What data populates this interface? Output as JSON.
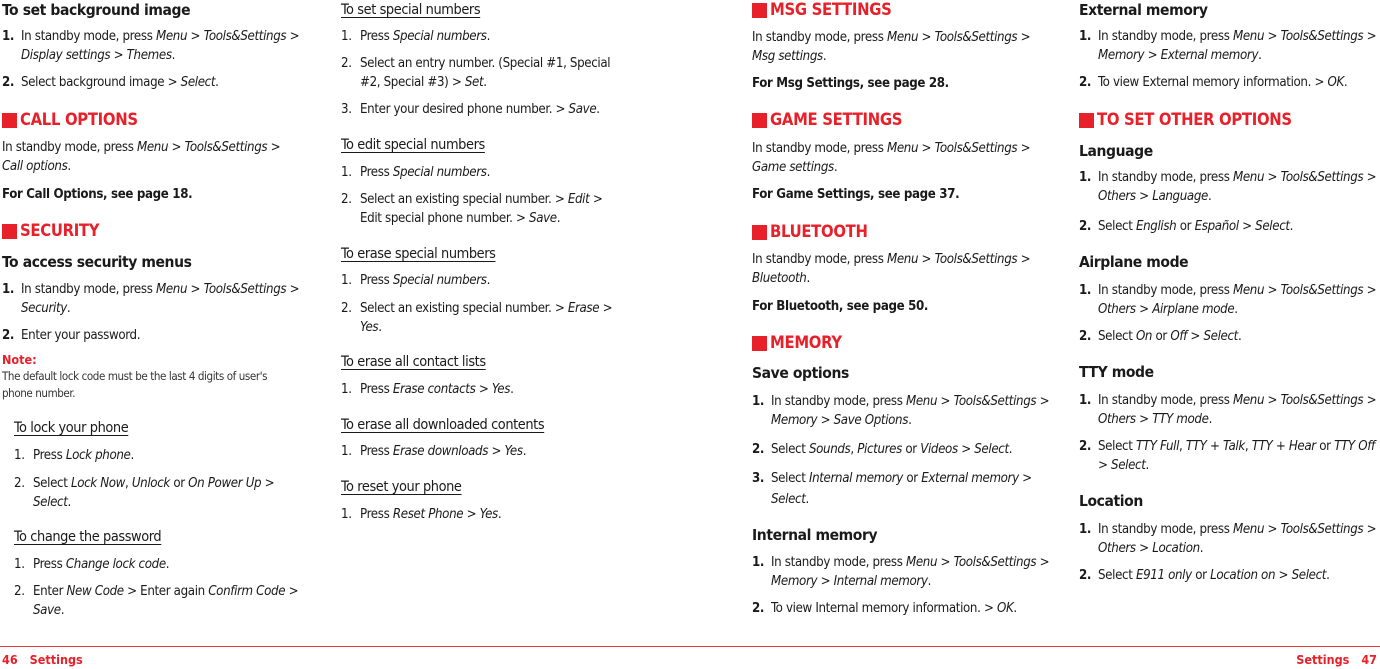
{
  "colors": {
    "accent": "#e8202a",
    "text": "#1a1a1a"
  },
  "footer": {
    "left_page": "46",
    "left_title": "Settings",
    "right_title": "Settings",
    "right_page": "47"
  },
  "col1": {
    "bg_heading": "To set background image",
    "bg_step1_pre": "In standby mode, press ",
    "bg_step1_i1": "Menu",
    "bg_step1_m1": " > ",
    "bg_step1_i2": "Tools&Settings",
    "bg_step1_m2": " > ",
    "bg_step1_i3": "Display settings",
    "bg_step1_m3": " > ",
    "bg_step1_i4": "Themes",
    "bg_step1_end": ".",
    "bg_step2_pre": "Select background image > ",
    "bg_step2_i1": "Select",
    "bg_step2_end": ".",
    "call_heading": "CALL OPTIONS",
    "call_text_pre": "In standby mode, press ",
    "call_text_i1": "Menu",
    "call_text_m1": " > ",
    "call_text_i2": "Tools&Settings",
    "call_text_m2": " > ",
    "call_text_i3": "Call options",
    "call_text_end": ".",
    "call_ref": "For Call Options, see page 18.",
    "security_heading": "SECURITY",
    "access_heading": "To access security menus",
    "access_step1_pre": "In standby mode, press ",
    "access_step1_i1": "Menu",
    "access_step1_m1": " > ",
    "access_step1_i2": "Tools&Settings",
    "access_step1_m2": " > ",
    "access_step1_i3": "Security",
    "access_step1_end": ".",
    "access_step2": "Enter your password.",
    "note_label": "Note:",
    "note_text": "The default lock code must be the last 4 digits of user's phone number.",
    "lock_heading": "To lock your phone",
    "lock_step1_pre": "Press ",
    "lock_step1_i1": "Lock phone",
    "lock_step1_end": ".",
    "lock_step2_pre": "Select ",
    "lock_step2_i1": "Lock Now",
    "lock_step2_m1": ", ",
    "lock_step2_i2": "Unlock",
    "lock_step2_m2": " or ",
    "lock_step2_i3": "On Power Up",
    "lock_step2_m3": " > ",
    "lock_step2_i4": "Select",
    "lock_step2_end": ".",
    "pw_heading": "To change the password",
    "pw_step1_pre": "Press ",
    "pw_step1_i1": "Change lock code",
    "pw_step1_end": ".",
    "pw_step2_pre": "Enter ",
    "pw_step2_i1": "New Code",
    "pw_step2_m1": " > Enter again ",
    "pw_step2_i2": "Confirm Code",
    "pw_step2_m2": " > ",
    "pw_step2_i3": "Save",
    "pw_step2_end": "."
  },
  "col2": {
    "set_heading": "To set special numbers",
    "set_step1_pre": "Press ",
    "set_step1_i1": "Special numbers",
    "set_step1_end": ".",
    "set_step2_pre": "Select an entry number. (Special #1, Special #2, Special #3) > ",
    "set_step2_i1": "Set",
    "set_step2_end": ".",
    "set_step3_pre": "Enter your desired phone number. > ",
    "set_step3_i1": "Save",
    "set_step3_end": ".",
    "edit_heading": "To edit special numbers",
    "edit_step1_pre": "Press ",
    "edit_step1_i1": "Special numbers",
    "edit_step1_end": ".",
    "edit_step2_pre": "Select an existing special number. > ",
    "edit_step2_i1": "Edit",
    "edit_step2_m1": " > Edit special phone number. > ",
    "edit_step2_i2": "Save",
    "edit_step2_end": ".",
    "erase_heading": "To erase special numbers",
    "erase_step1_pre": "Press ",
    "erase_step1_i1": "Special numbers",
    "erase_step1_end": ".",
    "erase_step2_pre": "Select an existing special number. > ",
    "erase_step2_i1": "Erase",
    "erase_step2_m1": " > ",
    "erase_step2_i2": "Yes",
    "erase_step2_end": ".",
    "contacts_heading": "To erase all contact lists",
    "contacts_step1_pre": "Press ",
    "contacts_step1_i1": "Erase contacts",
    "contacts_step1_m1": " > ",
    "contacts_step1_i2": "Yes",
    "contacts_step1_end": ".",
    "downloads_heading": "To erase all downloaded contents",
    "downloads_step1_pre": "Press ",
    "downloads_step1_i1": "Erase downloads",
    "downloads_step1_m1": " > ",
    "downloads_step1_i2": "Yes",
    "downloads_step1_end": ".",
    "reset_heading": "To reset your phone",
    "reset_step1_pre": "Press ",
    "reset_step1_i1": "Reset Phone",
    "reset_step1_m1": " > ",
    "reset_step1_i2": "Yes",
    "reset_step1_end": "."
  },
  "col3": {
    "msg_heading": "MSG SETTINGS",
    "msg_text_pre": "In standby mode, press ",
    "msg_text_i1": "Menu",
    "msg_text_m1": " > ",
    "msg_text_i2": "Tools&Settings",
    "msg_text_m2": " > ",
    "msg_text_i3": "Msg settings",
    "msg_text_end": ".",
    "msg_ref": "For Msg Settings, see page 28.",
    "game_heading": "GAME SETTINGS",
    "game_text_pre": "In standby mode, press ",
    "game_text_i1": "Menu",
    "game_text_m1": " > ",
    "game_text_i2": "Tools&Settings",
    "game_text_m2": " > ",
    "game_text_i3": "Game settings",
    "game_text_end": ".",
    "game_ref": "For Game Settings, see page 37.",
    "bt_heading": "BLUETOOTH",
    "bt_text_pre": "In standby mode, press ",
    "bt_text_i1": "Menu",
    "bt_text_m1": " > ",
    "bt_text_i2": "Tools&Settings",
    "bt_text_m2": " > ",
    "bt_text_i3": "Bluetooth",
    "bt_text_end": ".",
    "bt_ref": "For Bluetooth, see page 50.",
    "mem_heading": "MEMORY",
    "save_heading": "Save options",
    "save_step1_pre": "In standby mode, press ",
    "save_step1_i1": "Menu",
    "save_step1_m1": " > ",
    "save_step1_i2": "Tools&Settings",
    "save_step1_m2": " > ",
    "save_step1_i3": "Memory",
    "save_step1_m3": " > ",
    "save_step1_i4": "Save Options",
    "save_step1_end": ".",
    "save_step2_pre": "Select ",
    "save_step2_i1": "Sounds",
    "save_step2_m1": ", ",
    "save_step2_i2": "Pictures",
    "save_step2_m2": " or ",
    "save_step2_i3": "Videos",
    "save_step2_m3": " > ",
    "save_step2_i4": "Select",
    "save_step2_end": ".",
    "save_step3_pre": "Select ",
    "save_step3_i1": "Internal memory",
    "save_step3_m1": " or ",
    "save_step3_i2": "External memory",
    "save_step3_m2": " > ",
    "save_step3_i3": "Select",
    "save_step3_end": ".",
    "int_heading": "Internal memory",
    "int_step1_pre": "In standby mode, press ",
    "int_step1_i1": "Menu",
    "int_step1_m1": " > ",
    "int_step1_i2": "Tools&Settings",
    "int_step1_m2": " > ",
    "int_step1_i3": "Memory",
    "int_step1_m3": " > ",
    "int_step1_i4": "Internal memory",
    "int_step1_end": ".",
    "int_step2_pre": "To view Internal memory information. > ",
    "int_step2_i1": "OK",
    "int_step2_end": "."
  },
  "col4": {
    "ext_heading": "External memory",
    "ext_step1_pre": "In standby mode, press ",
    "ext_step1_i1": "Menu",
    "ext_step1_m1": " > ",
    "ext_step1_i2": "Tools&Settings",
    "ext_step1_m2": " > ",
    "ext_step1_i3": "Memory",
    "ext_step1_m3": " > ",
    "ext_step1_i4": "External memory",
    "ext_step1_end": ".",
    "ext_step2_pre": "To view External memory information. > ",
    "ext_step2_i1": "OK",
    "ext_step2_end": ".",
    "other_heading": "TO SET OTHER OPTIONS",
    "lang_heading": "Language",
    "lang_step1_pre": "In standby mode, press ",
    "lang_step1_i1": "Menu",
    "lang_step1_m1": " > ",
    "lang_step1_i2": "Tools&Settings",
    "lang_step1_m2": " > ",
    "lang_step1_i3": "Others",
    "lang_step1_m3": " > ",
    "lang_step1_i4": "Language",
    "lang_step1_end": ".",
    "lang_step2_pre": "Select ",
    "lang_step2_i1": "English",
    "lang_step2_m1": " or ",
    "lang_step2_i2": "Español",
    "lang_step2_m2": " > ",
    "lang_step2_i3": "Select",
    "lang_step2_end": ".",
    "air_heading": "Airplane mode",
    "air_step1_pre": "In standby mode, press ",
    "air_step1_i1": "Menu",
    "air_step1_m1": " > ",
    "air_step1_i2": "Tools&Settings",
    "air_step1_m2": " > ",
    "air_step1_i3": "Others",
    "air_step1_m3": " > ",
    "air_step1_i4": "Airplane mode",
    "air_step1_end": ".",
    "air_step2_pre": "Select ",
    "air_step2_i1": "On",
    "air_step2_m1": " or ",
    "air_step2_i2": "Off",
    "air_step2_m2": " > ",
    "air_step2_i3": "Select",
    "air_step2_end": ".",
    "tty_heading": "TTY mode",
    "tty_step1_pre": "In standby mode, press ",
    "tty_step1_i1": "Menu",
    "tty_step1_m1": " > ",
    "tty_step1_i2": "Tools&Settings",
    "tty_step1_m2": " > ",
    "tty_step1_i3": "Others",
    "tty_step1_m3": " > ",
    "tty_step1_i4": "TTY mode",
    "tty_step1_end": ".",
    "tty_step2_pre": "Select ",
    "tty_step2_i1": "TTY Full",
    "tty_step2_m1": ", ",
    "tty_step2_i2": "TTY + Talk",
    "tty_step2_m2": ", ",
    "tty_step2_i3": "TTY + Hear",
    "tty_step2_m3": " or ",
    "tty_step2_i4": "TTY Off",
    "tty_step2_m4": " > ",
    "tty_step2_i5": "Select",
    "tty_step2_end": ".",
    "loc_heading": "Location",
    "loc_step1_pre": "In standby mode, press ",
    "loc_step1_i1": "Menu",
    "loc_step1_m1": " > ",
    "loc_step1_i2": "Tools&Settings",
    "loc_step1_m2": " > ",
    "loc_step1_i3": "Others",
    "loc_step1_m3": " > ",
    "loc_step1_i4": "Location",
    "loc_step1_end": ".",
    "loc_step2_pre": "Select ",
    "loc_step2_i1": "E911 only",
    "loc_step2_m1": " or ",
    "loc_step2_i2": "Location on",
    "loc_step2_m2": " > ",
    "loc_step2_i3": "Select",
    "loc_step2_end": "."
  },
  "step_numbers": [
    "1.",
    "2.",
    "3."
  ]
}
